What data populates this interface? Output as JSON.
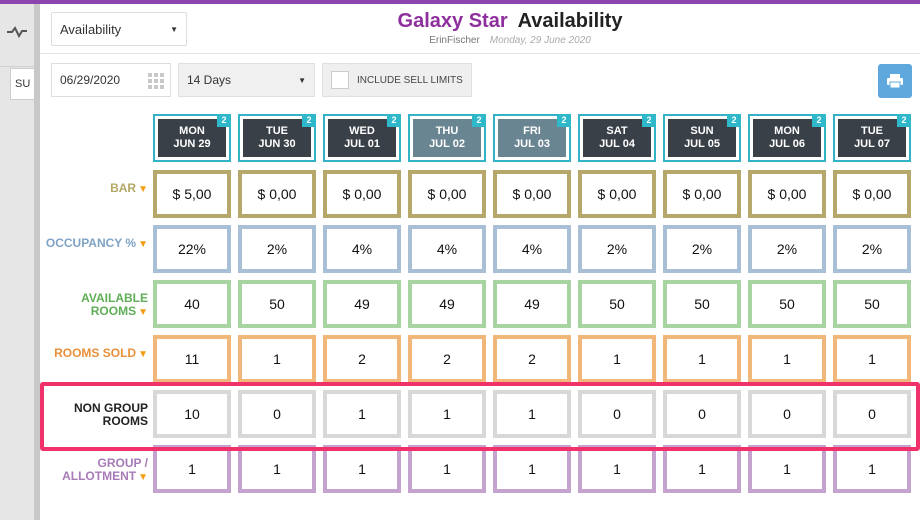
{
  "view_select": {
    "value": "Availability"
  },
  "title": {
    "hotel": "Galaxy Star",
    "page": "Availability",
    "user": "ErinFischer",
    "date": "Monday, 29 June 2020"
  },
  "left_stub": "SU",
  "toolbar": {
    "start_date": "06/29/2020",
    "range": "14 Days",
    "sell_limits_label": "INCLUDE SELL LIMITS"
  },
  "colors": {
    "bar": "#b5a86a",
    "occupancy": "#a9bfd6",
    "available": "#a8d4a2",
    "sold": "#f0b67a",
    "non_group": "#d8d8d8",
    "group": "#c4a3cf",
    "highlight": "#f0316a",
    "badge": "#2fb8c9"
  },
  "columns": [
    {
      "day": "MON",
      "date": "JUN 29",
      "badge": "2",
      "weekend": false
    },
    {
      "day": "TUE",
      "date": "JUN 30",
      "badge": "2",
      "weekend": false
    },
    {
      "day": "WED",
      "date": "JUL 01",
      "badge": "2",
      "weekend": false
    },
    {
      "day": "THU",
      "date": "JUL 02",
      "badge": "2",
      "weekend": true
    },
    {
      "day": "FRI",
      "date": "JUL 03",
      "badge": "2",
      "weekend": true
    },
    {
      "day": "SAT",
      "date": "JUL 04",
      "badge": "2",
      "weekend": false
    },
    {
      "day": "SUN",
      "date": "JUL 05",
      "badge": "2",
      "weekend": false
    },
    {
      "day": "MON",
      "date": "JUL 06",
      "badge": "2",
      "weekend": false
    },
    {
      "day": "TUE",
      "date": "JUL 07",
      "badge": "2",
      "weekend": false
    }
  ],
  "rows": [
    {
      "key": "bar",
      "label": "BAR",
      "label_color": "#b5a86a",
      "chevron": true,
      "values": [
        "$ 5,00",
        "$ 0,00",
        "$ 0,00",
        "$ 0,00",
        "$ 0,00",
        "$ 0,00",
        "$ 0,00",
        "$ 0,00",
        "$ 0,00"
      ]
    },
    {
      "key": "occupancy",
      "label": "OCCUPANCY %",
      "label_color": "#7fa3c4",
      "chevron": true,
      "values": [
        "22%",
        "2%",
        "4%",
        "4%",
        "4%",
        "2%",
        "2%",
        "2%",
        "2%"
      ]
    },
    {
      "key": "available",
      "label": "AVAILABLE ROOMS",
      "label_color": "#5fae57",
      "chevron": true,
      "values": [
        "40",
        "50",
        "49",
        "49",
        "49",
        "50",
        "50",
        "50",
        "50"
      ]
    },
    {
      "key": "sold",
      "label": "ROOMS SOLD",
      "label_color": "#e8913a",
      "chevron": true,
      "values": [
        "11",
        "1",
        "2",
        "2",
        "2",
        "1",
        "1",
        "1",
        "1"
      ]
    },
    {
      "key": "non_group",
      "label": "NON GROUP ROOMS",
      "label_color": "#222222",
      "chevron": false,
      "values": [
        "10",
        "0",
        "1",
        "1",
        "1",
        "0",
        "0",
        "0",
        "0"
      ]
    },
    {
      "key": "group",
      "label": "GROUP / ALLOTMENT",
      "label_color": "#a77bb8",
      "chevron": true,
      "values": [
        "1",
        "1",
        "1",
        "1",
        "1",
        "1",
        "1",
        "1",
        "1"
      ]
    }
  ]
}
